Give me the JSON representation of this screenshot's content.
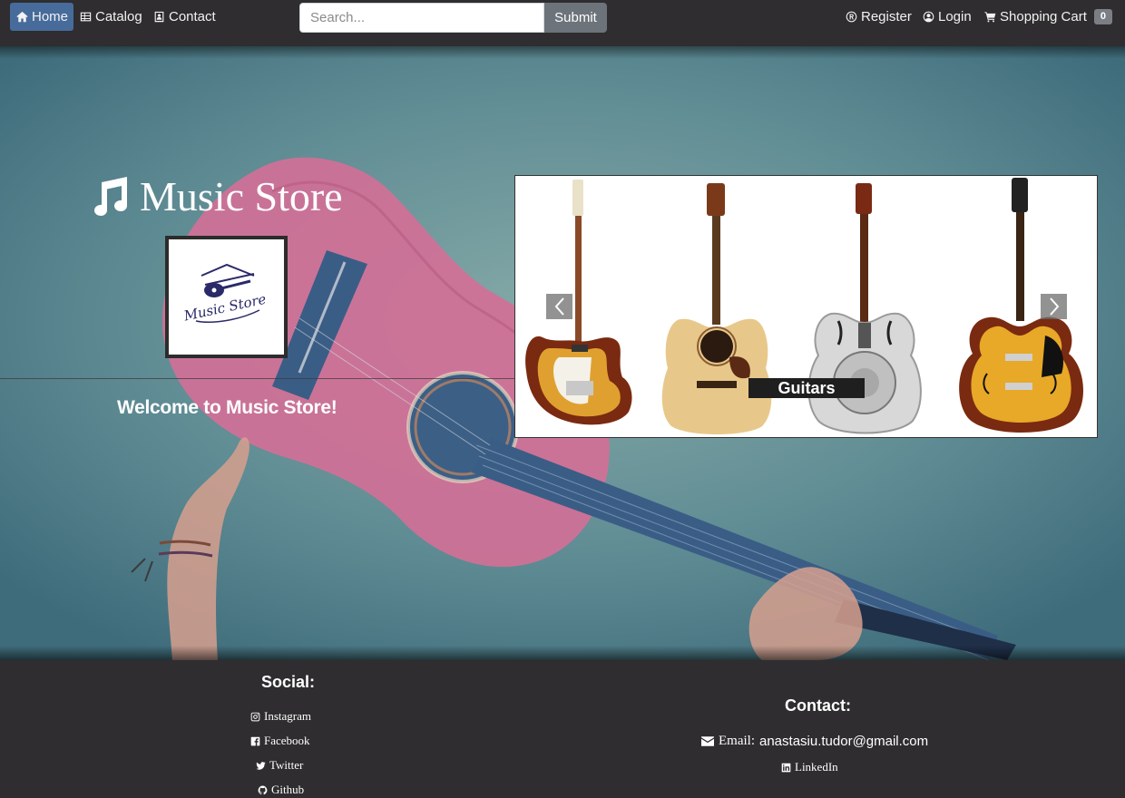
{
  "navbar": {
    "home_label": "Home",
    "catalog_label": "Catalog",
    "contact_label": "Contact",
    "search_placeholder": "Search...",
    "search_value": "",
    "submit_label": "Submit",
    "register_label": "Register",
    "login_label": "Login",
    "cart_label": "Shopping Cart",
    "cart_count": "0",
    "colors": {
      "bar": "#2f2d2f",
      "active": "#476b9b",
      "button": "#6c737a"
    }
  },
  "hero": {
    "title": "Music Store",
    "title_icon": "music-note-icon",
    "logo_text": "Music Store",
    "welcome": "Welcome to Music Store!"
  },
  "carousel": {
    "caption": "Guitars",
    "slide_image": "guitars-slide",
    "prev_icon": "chevron-left-icon",
    "next_icon": "chevron-right-icon"
  },
  "footer": {
    "social_heading": "Social:",
    "social_links": [
      {
        "label": "Instagram",
        "icon": "instagram-icon"
      },
      {
        "label": "Facebook",
        "icon": "facebook-icon"
      },
      {
        "label": "Twitter",
        "icon": "twitter-icon"
      },
      {
        "label": "Github",
        "icon": "github-icon"
      }
    ],
    "contact_heading": "Contact:",
    "email_label": "Email:",
    "email_value": "anastasiu.tudor@gmail.com",
    "linkedin_label": "LinkedIn"
  }
}
